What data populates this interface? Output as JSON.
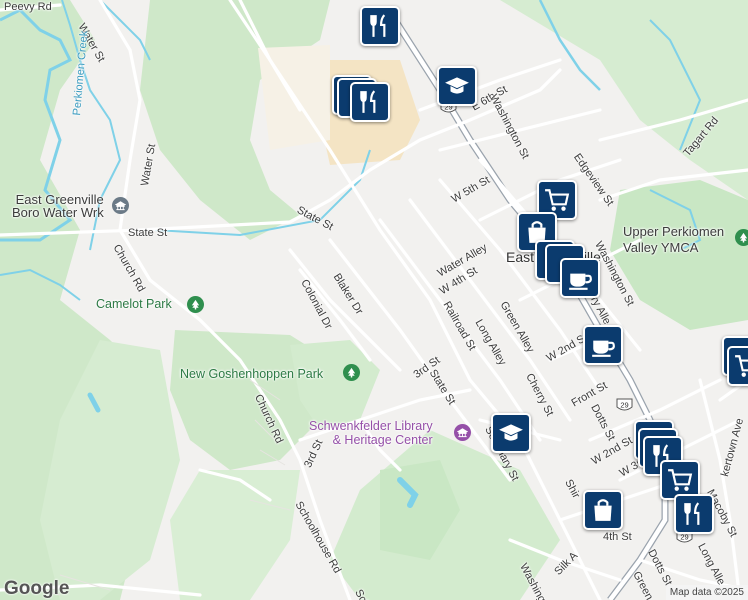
{
  "map": {
    "attribution": "Map data ©2025",
    "logo": "Google"
  },
  "streets": {
    "peevy_rd": "Peevy Rd",
    "water_st_north": "Water St",
    "water_st_mid": "Water St",
    "perkiomen_creek": "Perkiomen Creek",
    "state_st_west": "State St",
    "state_st_nw": "State St",
    "church_rd_north": "Church Rd",
    "church_rd_south": "Church Rd",
    "colonial_dr": "Colonial Dr",
    "blaker_dr": "Blaker Dr",
    "third_st_a": "3rd St",
    "third_st_b": "3rd St",
    "state_st_se": "State St",
    "schoolhouse_rd": "Schoolhouse Rd",
    "water_alley": "Water Alley",
    "w_4th_st": "W 4th St",
    "railroad_st": "Railroad St",
    "long_alley": "Long Alley",
    "green_alley": "Green Alley",
    "cherry_st": "Cherry St",
    "w_5th_st": "W 5th St",
    "e_6th_st": "E 6th St",
    "washington_st_n": "Washington St",
    "washington_st_e": "Washington St",
    "edgeview_st": "Edgeview St",
    "tagart_rd": "Tagart Rd",
    "w_2nd_st_a": "W 2nd St",
    "front_st": "Front St",
    "dotts_st": "Dotts St",
    "w_2nd_st_b": "W 2nd St",
    "w_3rd_st": "W 3rd St",
    "seminary_st": "Seminary St",
    "shirk": "Shir",
    "fourth_st": "4th St",
    "kertown_ave": "kertown Ave",
    "macoby_st": "Macoby St",
    "dotts_st_s": "Dotts St",
    "long_alley_s": "Long Alle",
    "washing": "Washing",
    "silk": "Silk A",
    "green_s": "Green",
    "pry_alley": "ry Alle",
    "sch": "Sch"
  },
  "places": {
    "east_greenville_water": "East Greenville\nBoro Water Wrk",
    "camelot_park": "Camelot Park",
    "new_goshenhoppen_park": "New Goshenhoppen Park",
    "schwenkfelder_library": "Schwenkfelder Library\n& Heritage Center",
    "upper_perkiomen_ymca": "Upper Perkiomen\nValley YMCA",
    "east_greenville_town": "East Greenville"
  },
  "route_shields": {
    "route_29_a": "29",
    "route_29_b": "29",
    "route_29_c": "29"
  },
  "markers": [
    {
      "kind": "restaurant",
      "name": "restaurant-icon"
    },
    {
      "kind": "school",
      "name": "school-icon"
    },
    {
      "kind": "restaurant",
      "name": "restaurant-icon"
    },
    {
      "kind": "shopping-cart",
      "name": "shopping-cart-icon"
    },
    {
      "kind": "shopping-bag",
      "name": "shopping-bag-icon"
    },
    {
      "kind": "cafe",
      "name": "cafe-icon"
    },
    {
      "kind": "cafe",
      "name": "cafe-icon"
    },
    {
      "kind": "school",
      "name": "school-icon"
    },
    {
      "kind": "restaurant",
      "name": "restaurant-icon"
    },
    {
      "kind": "shopping-cart",
      "name": "shopping-cart-icon"
    },
    {
      "kind": "shopping-bag",
      "name": "shopping-bag-icon"
    },
    {
      "kind": "restaurant",
      "name": "restaurant-icon"
    },
    {
      "kind": "shopping-cart",
      "name": "shopping-cart-icon"
    }
  ],
  "colors": {
    "land": "#f2f1ef",
    "park_green": "#c9e7c4",
    "forest_green": "#cfe8c9",
    "water_blue": "#7fd1e8",
    "marker_navy": "#0b3b6e",
    "campus_tan": "#f4e4c4"
  }
}
